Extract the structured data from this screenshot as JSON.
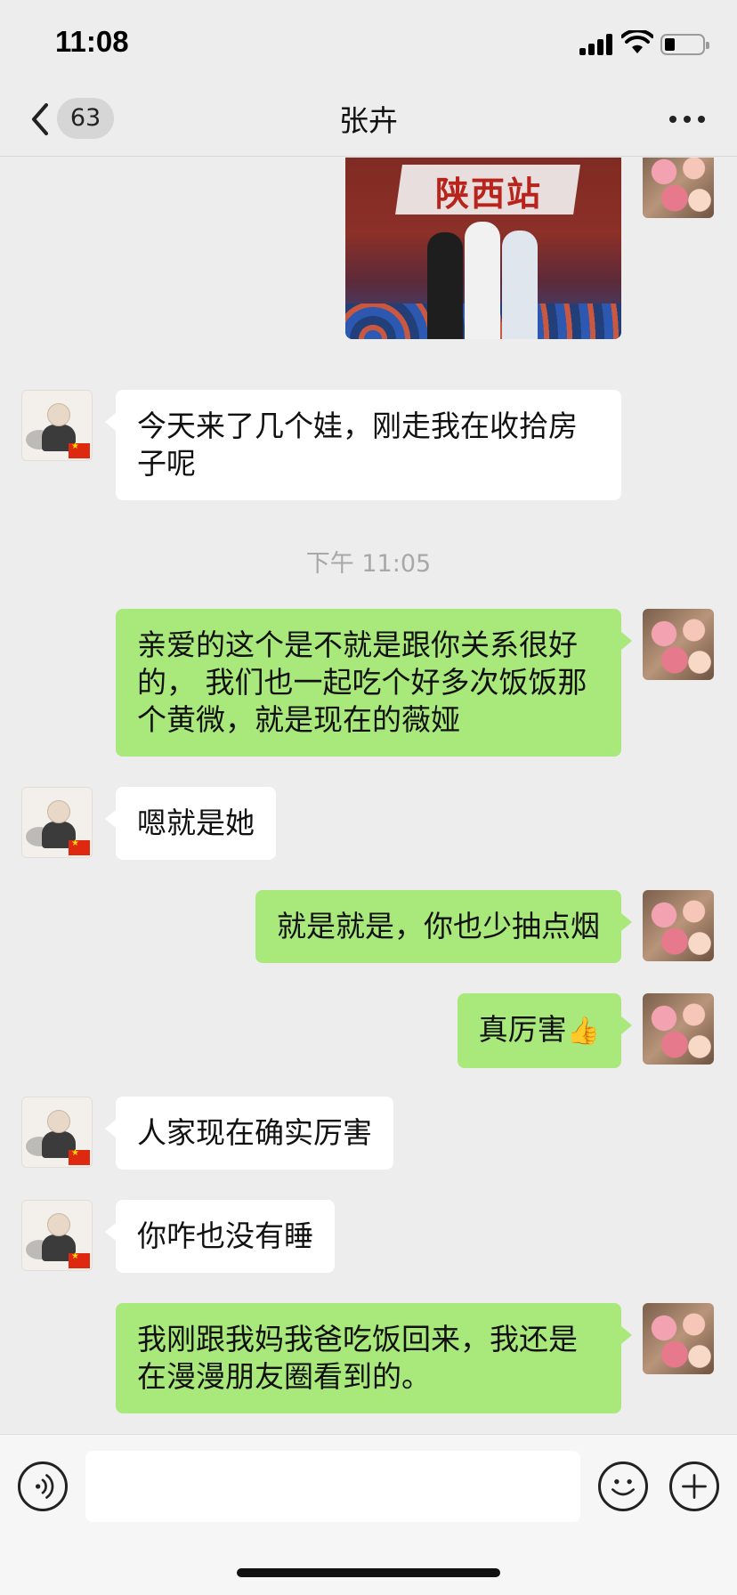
{
  "status_bar": {
    "time": "11:08"
  },
  "nav": {
    "unread_count": "63",
    "chat_title": "张卉"
  },
  "photo_message": {
    "banner_text": "陕西站"
  },
  "timestamp": "下午 11:05",
  "messages": [
    {
      "from": "peer",
      "text": "今天来了几个娃，刚走我在收拾房子呢"
    },
    {
      "from": "self",
      "text": "亲爱的这个是不就是跟你关系很好的， 我们也一起吃个好多次饭饭那个黄微，就是现在的薇娅"
    },
    {
      "from": "peer",
      "text": "嗯就是她"
    },
    {
      "from": "self",
      "text": "就是就是，你也少抽点烟"
    },
    {
      "from": "self",
      "text": "真厉害",
      "emoji": "👍"
    },
    {
      "from": "peer",
      "text": "人家现在确实厉害"
    },
    {
      "from": "peer",
      "text": "你咋也没有睡"
    },
    {
      "from": "self",
      "text": "我刚跟我妈我爸吃饭回来，我还是在漫漫朋友圈看到的。"
    }
  ],
  "input": {
    "value": ""
  },
  "icons": {
    "voice": "voice-icon",
    "emoji": "emoji-icon",
    "plus": "plus-icon",
    "back": "back-chevron-icon",
    "more": "more-icon"
  },
  "colors": {
    "background": "#ededed",
    "self_bubble": "#a9e87a",
    "peer_bubble": "#ffffff"
  }
}
